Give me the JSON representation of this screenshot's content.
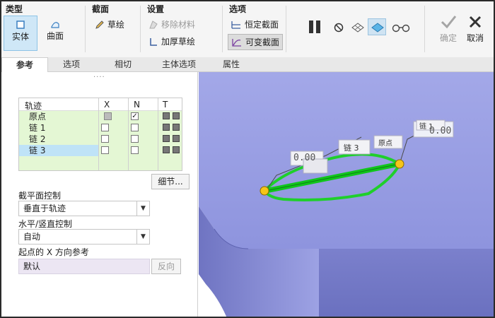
{
  "ribbon": {
    "groups": {
      "type": "类型",
      "section": "截面",
      "settings": "设置",
      "options": "选项"
    },
    "solid": "实体",
    "surface": "曲面",
    "sketch": "草绘",
    "remove_material": "移除材料",
    "thicken_sketch": "加厚草绘",
    "constant_section": "恒定截面",
    "variable_section": "可变截面",
    "confirm": "确定",
    "cancel": "取消"
  },
  "tabs": [
    "参考",
    "选项",
    "相切",
    "主体选项",
    "属性"
  ],
  "trajectory_table": {
    "headers": {
      "name": "轨迹",
      "x": "X",
      "n": "N",
      "t": "T"
    },
    "rows": [
      {
        "name": "原点",
        "x": "filled",
        "n": "checked",
        "t": true,
        "selected": false
      },
      {
        "name": "链 1",
        "x": "",
        "n": "",
        "t": true,
        "selected": false
      },
      {
        "name": "链 2",
        "x": "",
        "n": "",
        "t": true,
        "selected": false
      },
      {
        "name": "链 3",
        "x": "",
        "n": "",
        "t": true,
        "selected": true
      }
    ]
  },
  "details_button": "细节...",
  "section_plane_control": {
    "label": "截平面控制",
    "value": "垂直于轨迹"
  },
  "hv_control": {
    "label": "水平/竖直控制",
    "value": "自动"
  },
  "x_ref": {
    "label": "起点的 X 方向参考",
    "value": "默认",
    "flip": "反向"
  },
  "viewport_labels": {
    "dim1": "0.00",
    "dim2": "0.00",
    "chain3": "链 3",
    "origin": "原点",
    "chain1": "链 1"
  }
}
